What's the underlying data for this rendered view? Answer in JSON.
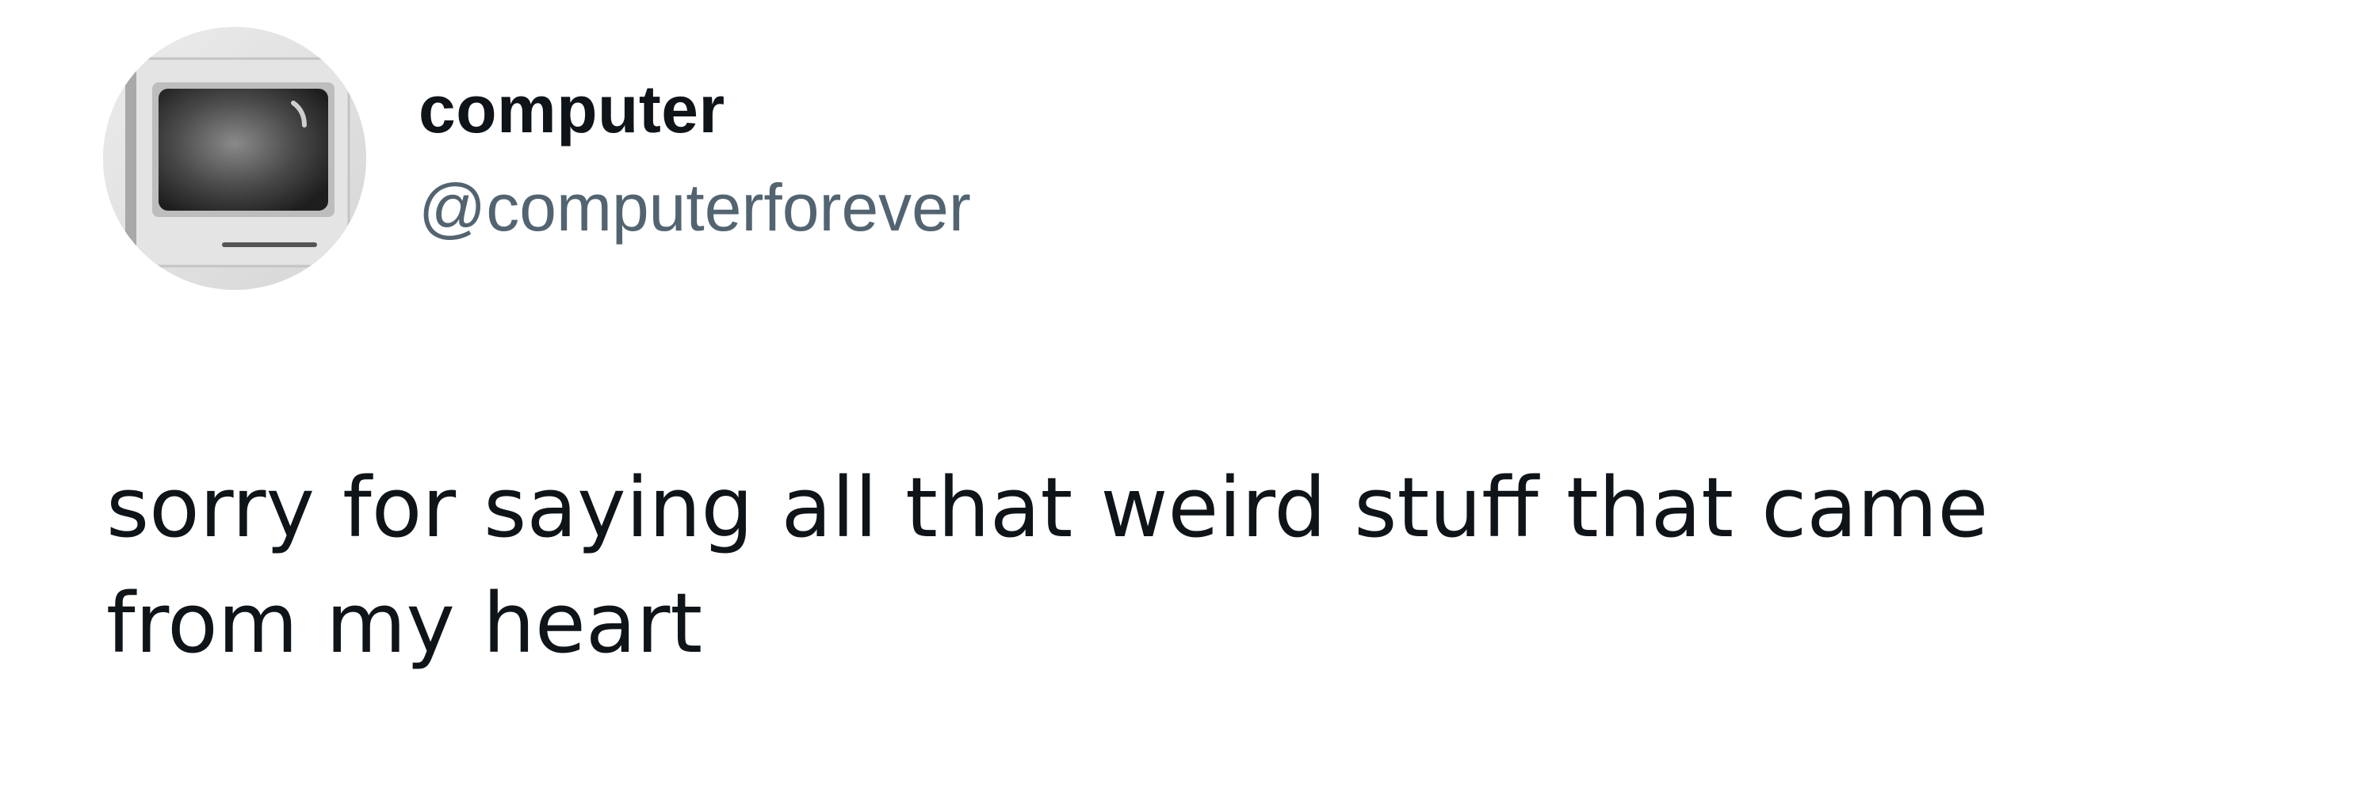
{
  "tweet": {
    "author": {
      "display_name": "computer",
      "handle": "@computerforever"
    },
    "text": "sorry for saying all that weird stuff that came from my heart"
  },
  "icons": {
    "avatar": "vintage-computer-monitor-icon"
  }
}
